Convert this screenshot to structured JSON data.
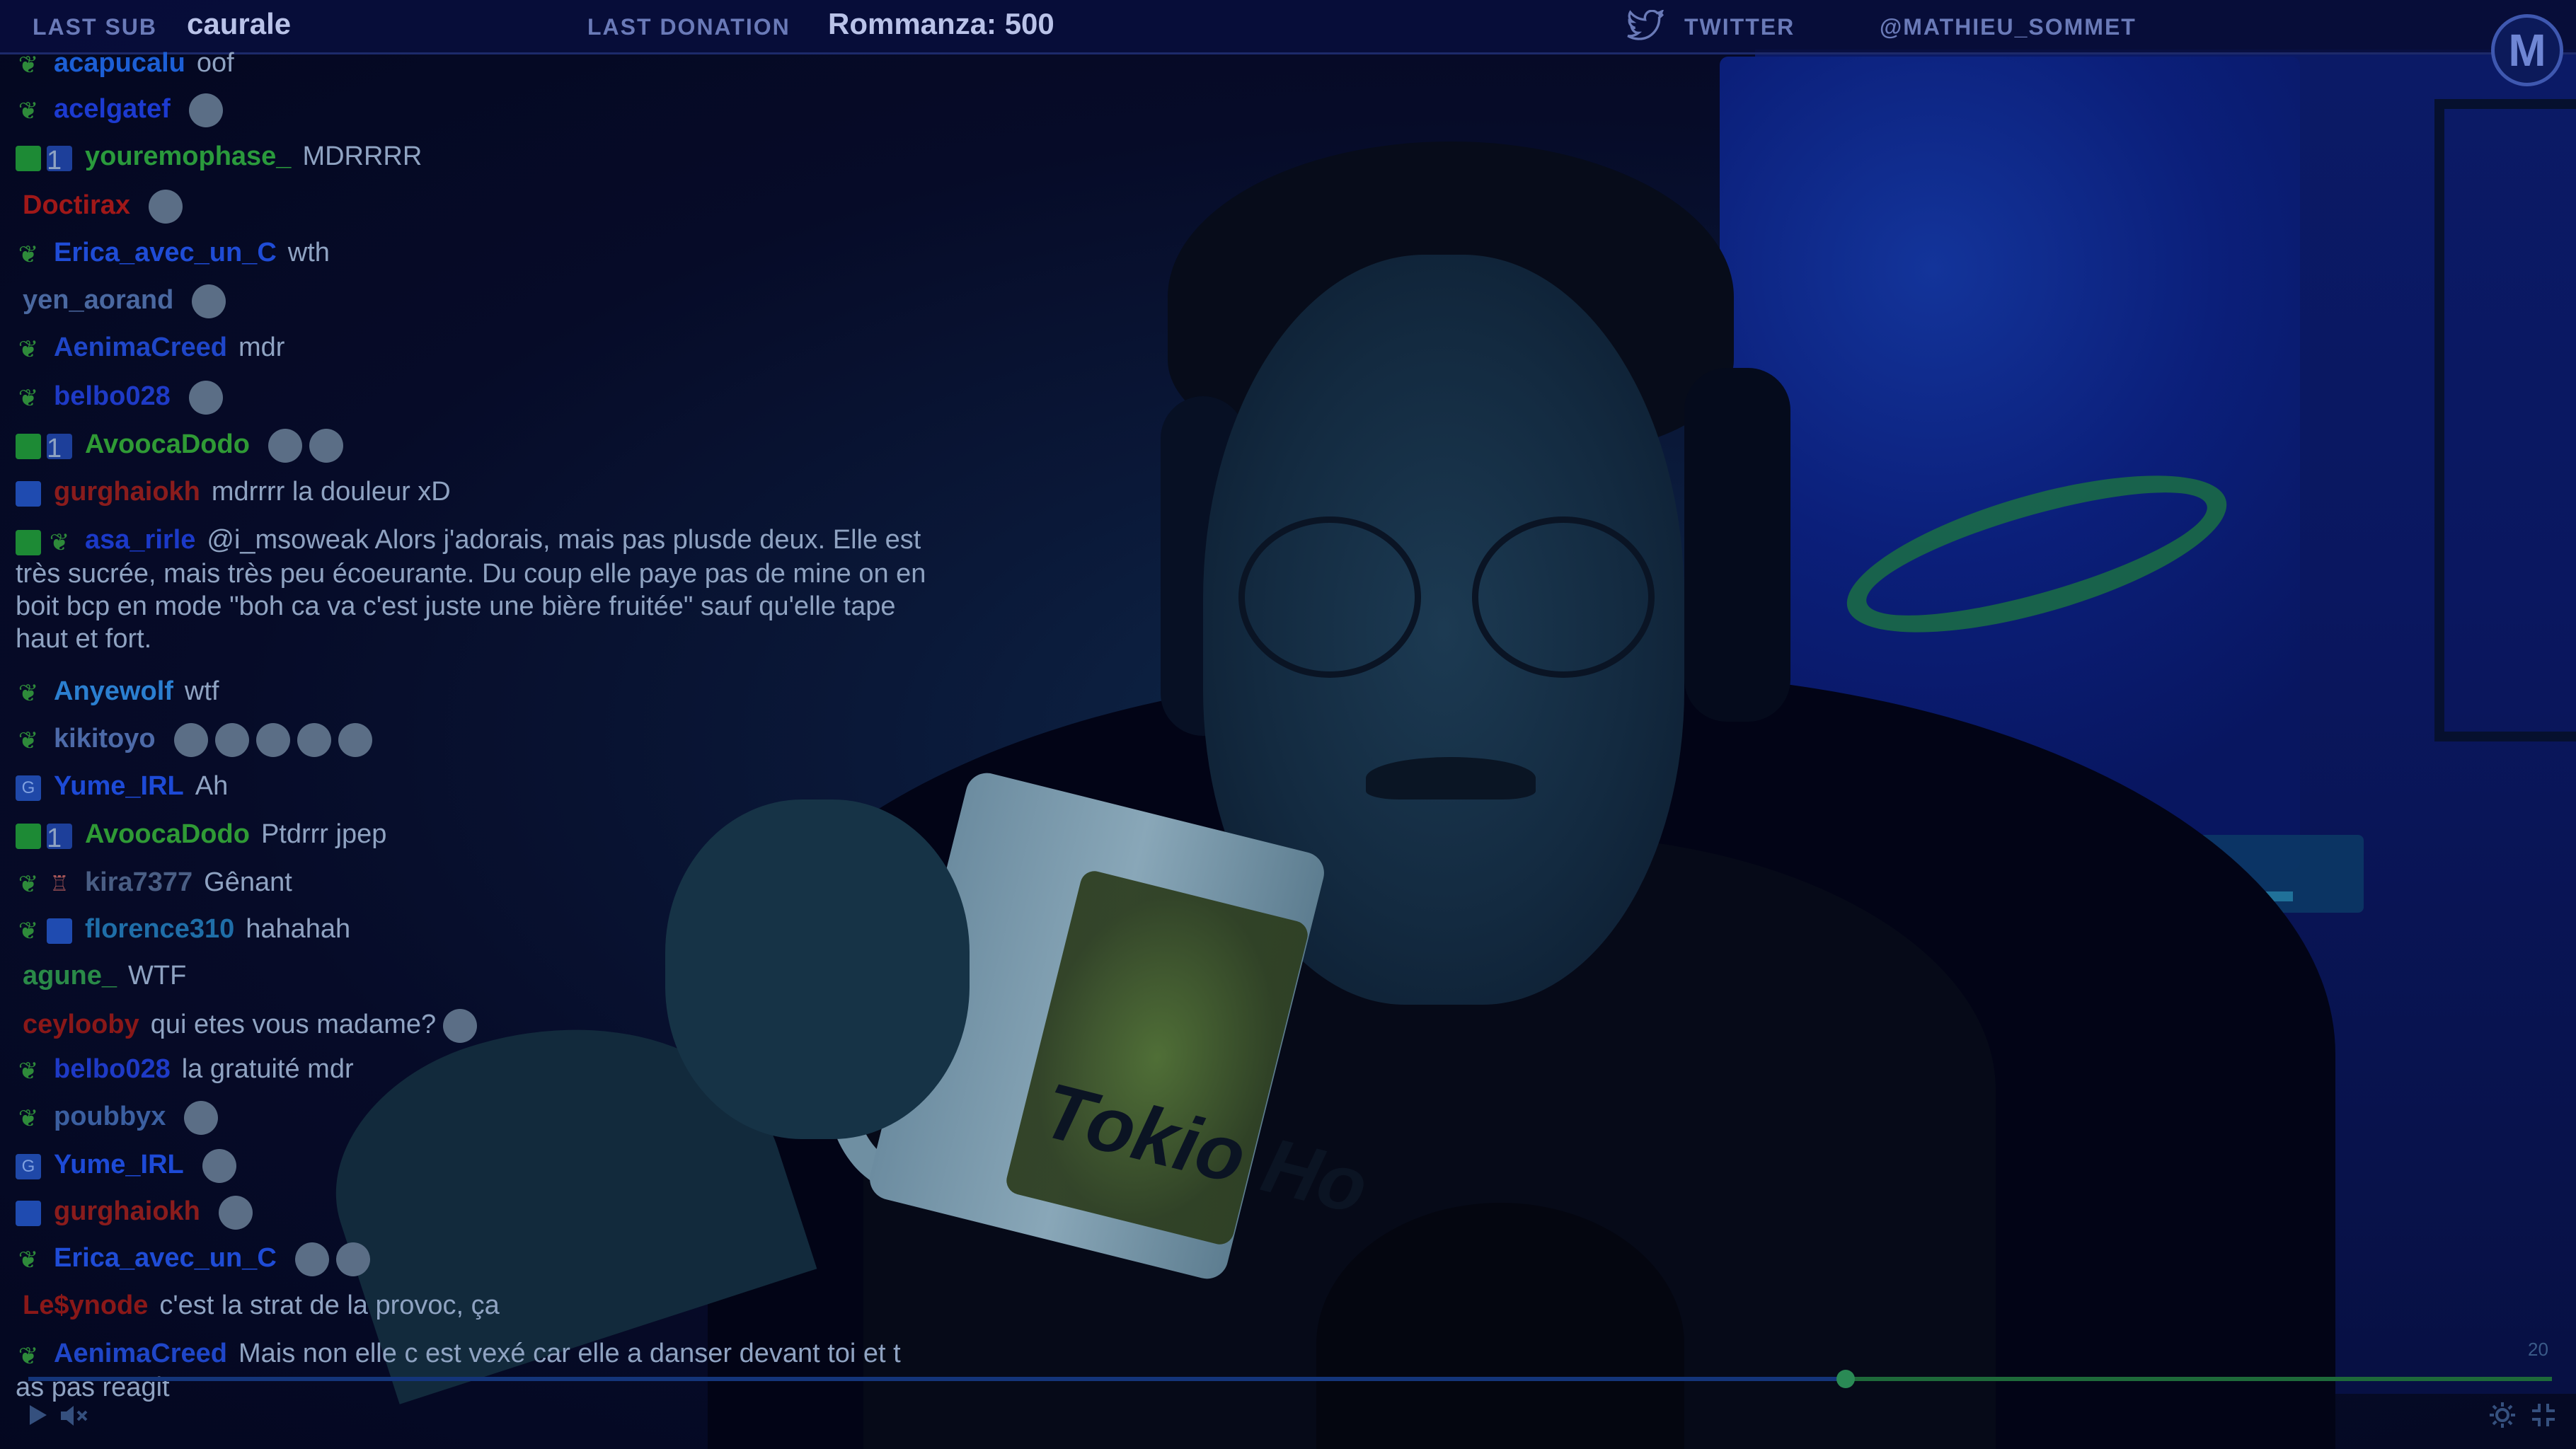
{
  "topbar": {
    "last_sub_label": "LAST SUB",
    "last_sub_value": "caurale",
    "last_donation_label": "LAST DONATION",
    "last_donation_value": "Rommanza: 500",
    "twitter_label": "TWITTER",
    "twitter_handle": "@MATHIEU_SOMMET",
    "logo_text": "M"
  },
  "chat": {
    "messages": [
      {
        "user": "acapucalu",
        "text": "oof",
        "color": "#1c5fd6",
        "badges": [
          "leaf"
        ]
      },
      {
        "user": "acelgatef",
        "text": "",
        "color": "#1c3ad0",
        "badges": [
          "leaf"
        ],
        "emotes": 1
      },
      {
        "user": "youremophase_",
        "text": "MDRRRR",
        "color": "#2a9a3c",
        "badges": [
          "mod",
          "sub"
        ]
      },
      {
        "user": "Doctirax",
        "text": "",
        "color": "#a01818",
        "badges": [],
        "emotes": 1
      },
      {
        "user": "Erica_avec_un_C",
        "text": "wth",
        "color": "#1f4cd6",
        "badges": [
          "leaf"
        ]
      },
      {
        "user": "yen_aorand",
        "text": "",
        "color": "#4a68a0",
        "badges": [],
        "emotes": 1
      },
      {
        "user": "AenimaCreed",
        "text": "mdr",
        "color": "#1f46c8",
        "badges": [
          "leaf"
        ]
      },
      {
        "user": "belbo028",
        "text": "",
        "color": "#1e3ac6",
        "badges": [
          "leaf"
        ],
        "emotes": 1
      },
      {
        "user": "AvoocaDodo",
        "text": "",
        "color": "#2f9a35",
        "badges": [
          "mod",
          "sub"
        ],
        "emotes": 2
      },
      {
        "user": "gurghaiokh",
        "text": "mdrrrr la douleur xD",
        "color": "#8a1c1c",
        "badges": [
          "crown"
        ]
      },
      {
        "user": "asa_rirle",
        "text": "@i_msoweak Alors j'adorais, mais pas plusde deux. Elle est très sucrée, mais très peu écoeurante. Du coup elle paye pas de mine on en boit bcp en mode \"boh ca va c'est juste une bière fruitée\" sauf qu'elle tape haut et fort.",
        "color": "#1b39c8",
        "badges": [
          "mod",
          "leaf"
        ]
      },
      {
        "user": "Anyewolf",
        "text": "wtf",
        "color": "#2b7fd0",
        "badges": [
          "leaf"
        ]
      },
      {
        "user": "kikitoyo",
        "text": "",
        "color": "#4d6aa8",
        "badges": [
          "leaf"
        ],
        "emotes": 5
      },
      {
        "user": "Yume_IRL",
        "text": "Ah",
        "color": "#1d4ad6",
        "badges": [
          "g"
        ]
      },
      {
        "user": "AvoocaDodo",
        "text": "Ptdrrr jpep",
        "color": "#2f9a35",
        "badges": [
          "mod",
          "sub"
        ]
      },
      {
        "user": "kira7377",
        "text": "Gênant",
        "color": "#4a5e84",
        "badges": [
          "leaf",
          "cake"
        ]
      },
      {
        "user": "florence310",
        "text": "hahahah",
        "color": "#1f6ea8",
        "badges": [
          "leaf",
          "crown"
        ]
      },
      {
        "user": "agune_",
        "text": "WTF",
        "color": "#2a8a48",
        "badges": []
      },
      {
        "user": "ceylooby",
        "text": "qui etes vous madame?",
        "color": "#8a1818",
        "badges": [],
        "emotes": 1
      },
      {
        "user": "belbo028",
        "text": "la gratuité mdr",
        "color": "#1e3ac6",
        "badges": [
          "leaf"
        ]
      },
      {
        "user": "poubbyx",
        "text": "",
        "color": "#3b5fa0",
        "badges": [
          "leaf"
        ],
        "emotes": 1
      },
      {
        "user": "Yume_IRL",
        "text": "",
        "color": "#1d4ad6",
        "badges": [
          "g"
        ],
        "emotes": 1
      },
      {
        "user": "gurghaiokh",
        "text": "",
        "color": "#8a1c1c",
        "badges": [
          "crown"
        ],
        "emotes": 1
      },
      {
        "user": "Erica_avec_un_C",
        "text": "",
        "color": "#1f4cd6",
        "badges": [
          "leaf"
        ],
        "emotes": 2
      },
      {
        "user": "Le$ynode",
        "text": "c'est la strat de la provoc, ça",
        "color": "#8a1818",
        "badges": []
      },
      {
        "user": "AenimaCreed",
        "text": "Mais non elle c est vexé car elle a danser devant toi et t as pas reagit",
        "color": "#1f46c8",
        "badges": [
          "leaf"
        ]
      }
    ]
  },
  "player": {
    "progress": 0.72,
    "time_label": "20",
    "play_icon": "play-icon",
    "volume_icon": "volume-muted-icon",
    "settings_icon": "gear-icon",
    "fullscreen_icon": "exit-fullscreen-icon"
  },
  "mug_text": "Tokio Ho"
}
